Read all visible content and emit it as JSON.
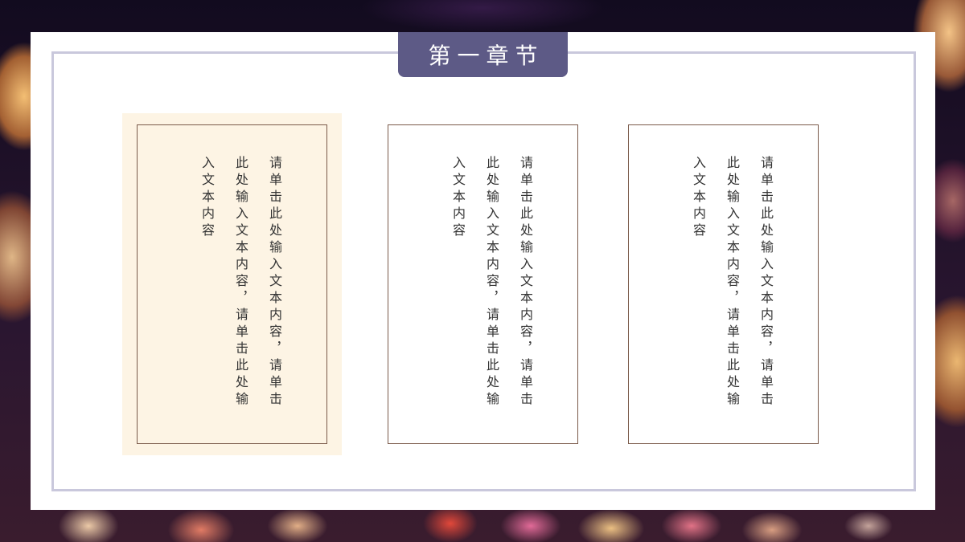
{
  "slide": {
    "title": "第一章节",
    "boxes": [
      {
        "text": "请单击此处输入文本内容，请单击此处输入文本内容，请单击此处输入文本内容"
      },
      {
        "text": "请单击此处输入文本内容，请单击此处输入文本内容，请单击此处输入文本内容"
      },
      {
        "text": "请单击此处输入文本内容，请单击此处输入文本内容，请单击此处输入文本内容"
      }
    ]
  },
  "colors": {
    "title_tab": "#5d5a86",
    "frame": "#c9c8dc",
    "highlight_fill": "#fdf4e4",
    "box_border": "#7a5a4a"
  }
}
